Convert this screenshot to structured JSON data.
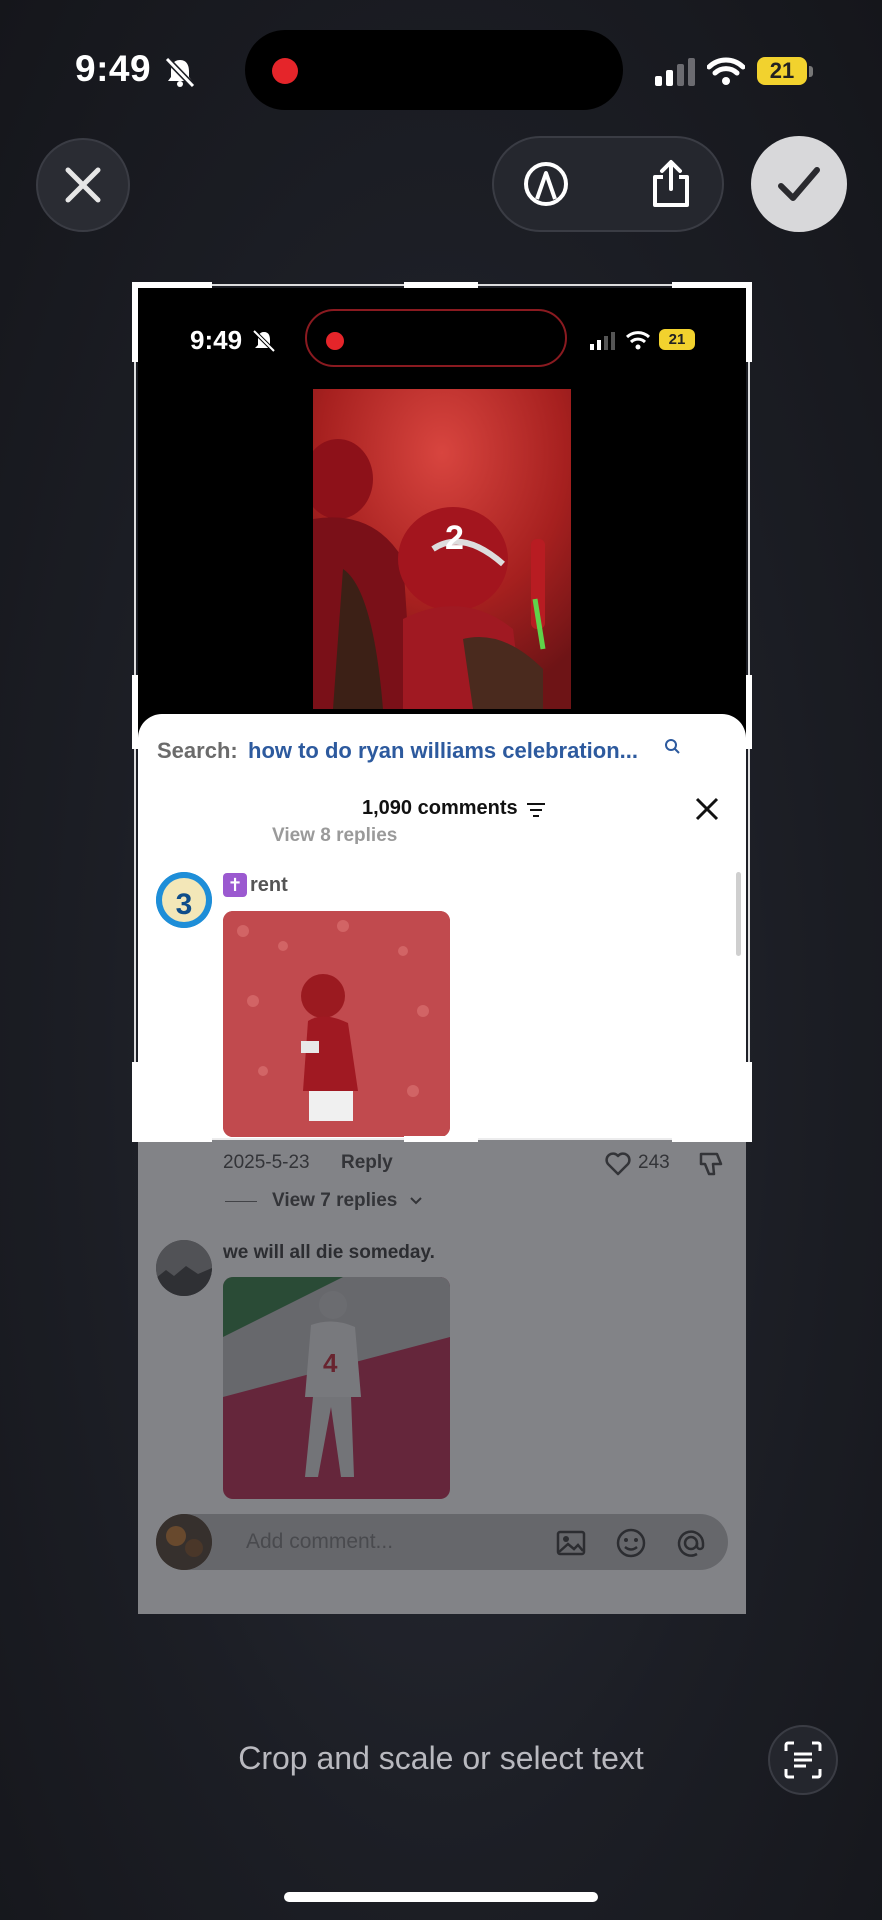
{
  "status_bar": {
    "time": "9:49",
    "battery": "21"
  },
  "editor": {
    "close_label": "close",
    "hint": "Crop and scale or select text"
  },
  "inner_status": {
    "time": "9:49",
    "battery": "21"
  },
  "sheet": {
    "search_label": "Search:",
    "search_query": "how to do ryan williams celebration...",
    "comment_count": "1,090 comments",
    "partial_replies": "View 8 replies",
    "comments": [
      {
        "username": "rent",
        "date": "2025-5-23",
        "reply": "Reply",
        "likes": "243",
        "view_replies": "View 7 replies"
      },
      {
        "text": "we will all die someday."
      }
    ],
    "add_comment_placeholder": "Add comment..."
  },
  "colors": {
    "accent_blue": "#2d5a9e",
    "alabama_red": "#9b1e22",
    "record_red": "#e5252a"
  }
}
